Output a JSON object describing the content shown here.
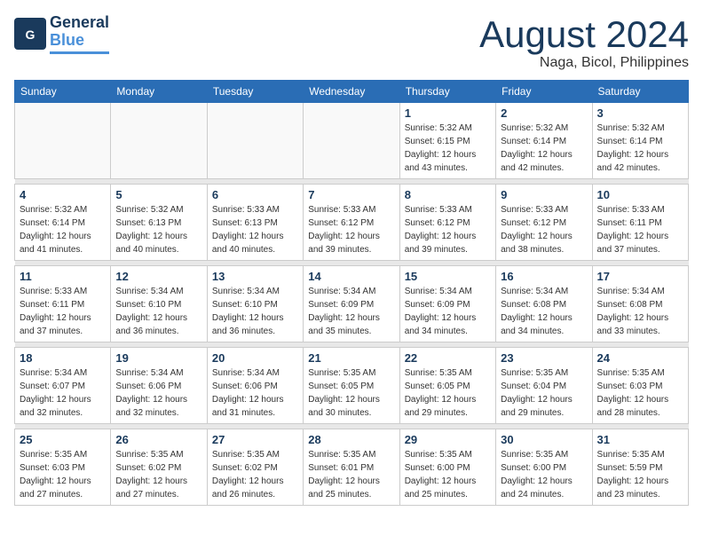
{
  "logo": {
    "general": "General",
    "blue": "Blue"
  },
  "title": "August 2024",
  "subtitle": "Naga, Bicol, Philippines",
  "weekdays": [
    "Sunday",
    "Monday",
    "Tuesday",
    "Wednesday",
    "Thursday",
    "Friday",
    "Saturday"
  ],
  "weeks": [
    [
      {
        "day": "",
        "info": ""
      },
      {
        "day": "",
        "info": ""
      },
      {
        "day": "",
        "info": ""
      },
      {
        "day": "",
        "info": ""
      },
      {
        "day": "1",
        "info": "Sunrise: 5:32 AM\nSunset: 6:15 PM\nDaylight: 12 hours\nand 43 minutes."
      },
      {
        "day": "2",
        "info": "Sunrise: 5:32 AM\nSunset: 6:14 PM\nDaylight: 12 hours\nand 42 minutes."
      },
      {
        "day": "3",
        "info": "Sunrise: 5:32 AM\nSunset: 6:14 PM\nDaylight: 12 hours\nand 42 minutes."
      }
    ],
    [
      {
        "day": "4",
        "info": "Sunrise: 5:32 AM\nSunset: 6:14 PM\nDaylight: 12 hours\nand 41 minutes."
      },
      {
        "day": "5",
        "info": "Sunrise: 5:32 AM\nSunset: 6:13 PM\nDaylight: 12 hours\nand 40 minutes."
      },
      {
        "day": "6",
        "info": "Sunrise: 5:33 AM\nSunset: 6:13 PM\nDaylight: 12 hours\nand 40 minutes."
      },
      {
        "day": "7",
        "info": "Sunrise: 5:33 AM\nSunset: 6:12 PM\nDaylight: 12 hours\nand 39 minutes."
      },
      {
        "day": "8",
        "info": "Sunrise: 5:33 AM\nSunset: 6:12 PM\nDaylight: 12 hours\nand 39 minutes."
      },
      {
        "day": "9",
        "info": "Sunrise: 5:33 AM\nSunset: 6:12 PM\nDaylight: 12 hours\nand 38 minutes."
      },
      {
        "day": "10",
        "info": "Sunrise: 5:33 AM\nSunset: 6:11 PM\nDaylight: 12 hours\nand 37 minutes."
      }
    ],
    [
      {
        "day": "11",
        "info": "Sunrise: 5:33 AM\nSunset: 6:11 PM\nDaylight: 12 hours\nand 37 minutes."
      },
      {
        "day": "12",
        "info": "Sunrise: 5:34 AM\nSunset: 6:10 PM\nDaylight: 12 hours\nand 36 minutes."
      },
      {
        "day": "13",
        "info": "Sunrise: 5:34 AM\nSunset: 6:10 PM\nDaylight: 12 hours\nand 36 minutes."
      },
      {
        "day": "14",
        "info": "Sunrise: 5:34 AM\nSunset: 6:09 PM\nDaylight: 12 hours\nand 35 minutes."
      },
      {
        "day": "15",
        "info": "Sunrise: 5:34 AM\nSunset: 6:09 PM\nDaylight: 12 hours\nand 34 minutes."
      },
      {
        "day": "16",
        "info": "Sunrise: 5:34 AM\nSunset: 6:08 PM\nDaylight: 12 hours\nand 34 minutes."
      },
      {
        "day": "17",
        "info": "Sunrise: 5:34 AM\nSunset: 6:08 PM\nDaylight: 12 hours\nand 33 minutes."
      }
    ],
    [
      {
        "day": "18",
        "info": "Sunrise: 5:34 AM\nSunset: 6:07 PM\nDaylight: 12 hours\nand 32 minutes."
      },
      {
        "day": "19",
        "info": "Sunrise: 5:34 AM\nSunset: 6:06 PM\nDaylight: 12 hours\nand 32 minutes."
      },
      {
        "day": "20",
        "info": "Sunrise: 5:34 AM\nSunset: 6:06 PM\nDaylight: 12 hours\nand 31 minutes."
      },
      {
        "day": "21",
        "info": "Sunrise: 5:35 AM\nSunset: 6:05 PM\nDaylight: 12 hours\nand 30 minutes."
      },
      {
        "day": "22",
        "info": "Sunrise: 5:35 AM\nSunset: 6:05 PM\nDaylight: 12 hours\nand 29 minutes."
      },
      {
        "day": "23",
        "info": "Sunrise: 5:35 AM\nSunset: 6:04 PM\nDaylight: 12 hours\nand 29 minutes."
      },
      {
        "day": "24",
        "info": "Sunrise: 5:35 AM\nSunset: 6:03 PM\nDaylight: 12 hours\nand 28 minutes."
      }
    ],
    [
      {
        "day": "25",
        "info": "Sunrise: 5:35 AM\nSunset: 6:03 PM\nDaylight: 12 hours\nand 27 minutes."
      },
      {
        "day": "26",
        "info": "Sunrise: 5:35 AM\nSunset: 6:02 PM\nDaylight: 12 hours\nand 27 minutes."
      },
      {
        "day": "27",
        "info": "Sunrise: 5:35 AM\nSunset: 6:02 PM\nDaylight: 12 hours\nand 26 minutes."
      },
      {
        "day": "28",
        "info": "Sunrise: 5:35 AM\nSunset: 6:01 PM\nDaylight: 12 hours\nand 25 minutes."
      },
      {
        "day": "29",
        "info": "Sunrise: 5:35 AM\nSunset: 6:00 PM\nDaylight: 12 hours\nand 25 minutes."
      },
      {
        "day": "30",
        "info": "Sunrise: 5:35 AM\nSunset: 6:00 PM\nDaylight: 12 hours\nand 24 minutes."
      },
      {
        "day": "31",
        "info": "Sunrise: 5:35 AM\nSunset: 5:59 PM\nDaylight: 12 hours\nand 23 minutes."
      }
    ]
  ]
}
